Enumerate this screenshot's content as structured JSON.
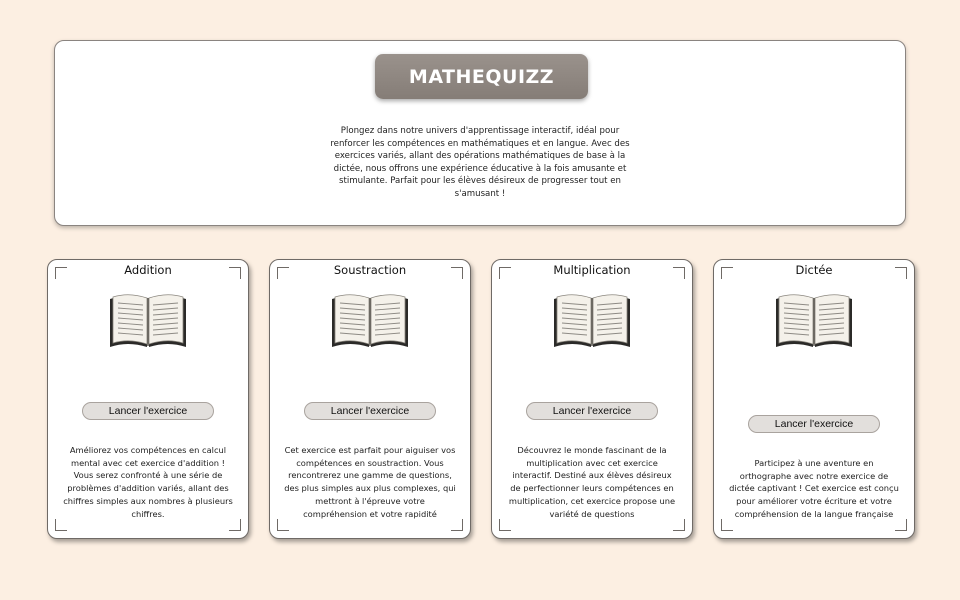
{
  "header": {
    "title": "MATHEQUIZZ",
    "intro": "Plongez dans notre univers d'apprentissage interactif, idéal pour renforcer les compétences en mathématiques et en langue. Avec des exercices variés, allant des opérations mathématiques de base à la dictée, nous offrons une expérience éducative à la fois amusante et stimulante. Parfait pour les élèves désireux de progresser tout en s'amusant !"
  },
  "cards": [
    {
      "title": "Addition",
      "button_label": "Lancer l'exercice",
      "icon": "open-book-icon",
      "description": "Améliorez vos compétences en calcul mental avec cet exercice d'addition ! Vous serez confronté à une série de problèmes d'addition variés, allant des chiffres simples aux nombres à plusieurs chiffres."
    },
    {
      "title": "Soustraction",
      "button_label": "Lancer l'exercice",
      "icon": "open-book-icon",
      "description": "Cet exercice est parfait pour aiguiser vos compétences en soustraction. Vous rencontrerez une gamme de questions, des plus simples aux plus complexes, qui mettront à l'épreuve votre compréhension et votre rapidité"
    },
    {
      "title": "Multiplication",
      "button_label": "Lancer l'exercice",
      "icon": "open-book-icon",
      "description": "Découvrez le monde fascinant de la multiplication avec cet exercice interactif. Destiné aux élèves désireux de perfectionner leurs compétences en multiplication, cet exercice propose une variété de questions"
    },
    {
      "title": "Dictée",
      "button_label": "Lancer l'exercice",
      "icon": "open-book-icon",
      "description": "Participez à une aventure en orthographe avec notre exercice de dictée captivant ! Cet exercice est conçu pour améliorer votre écriture et votre compréhension de la langue française"
    }
  ],
  "colors": {
    "page_background": "#fcefe2",
    "title_box": "#8f8781",
    "button_background": "#e2dfdc"
  }
}
